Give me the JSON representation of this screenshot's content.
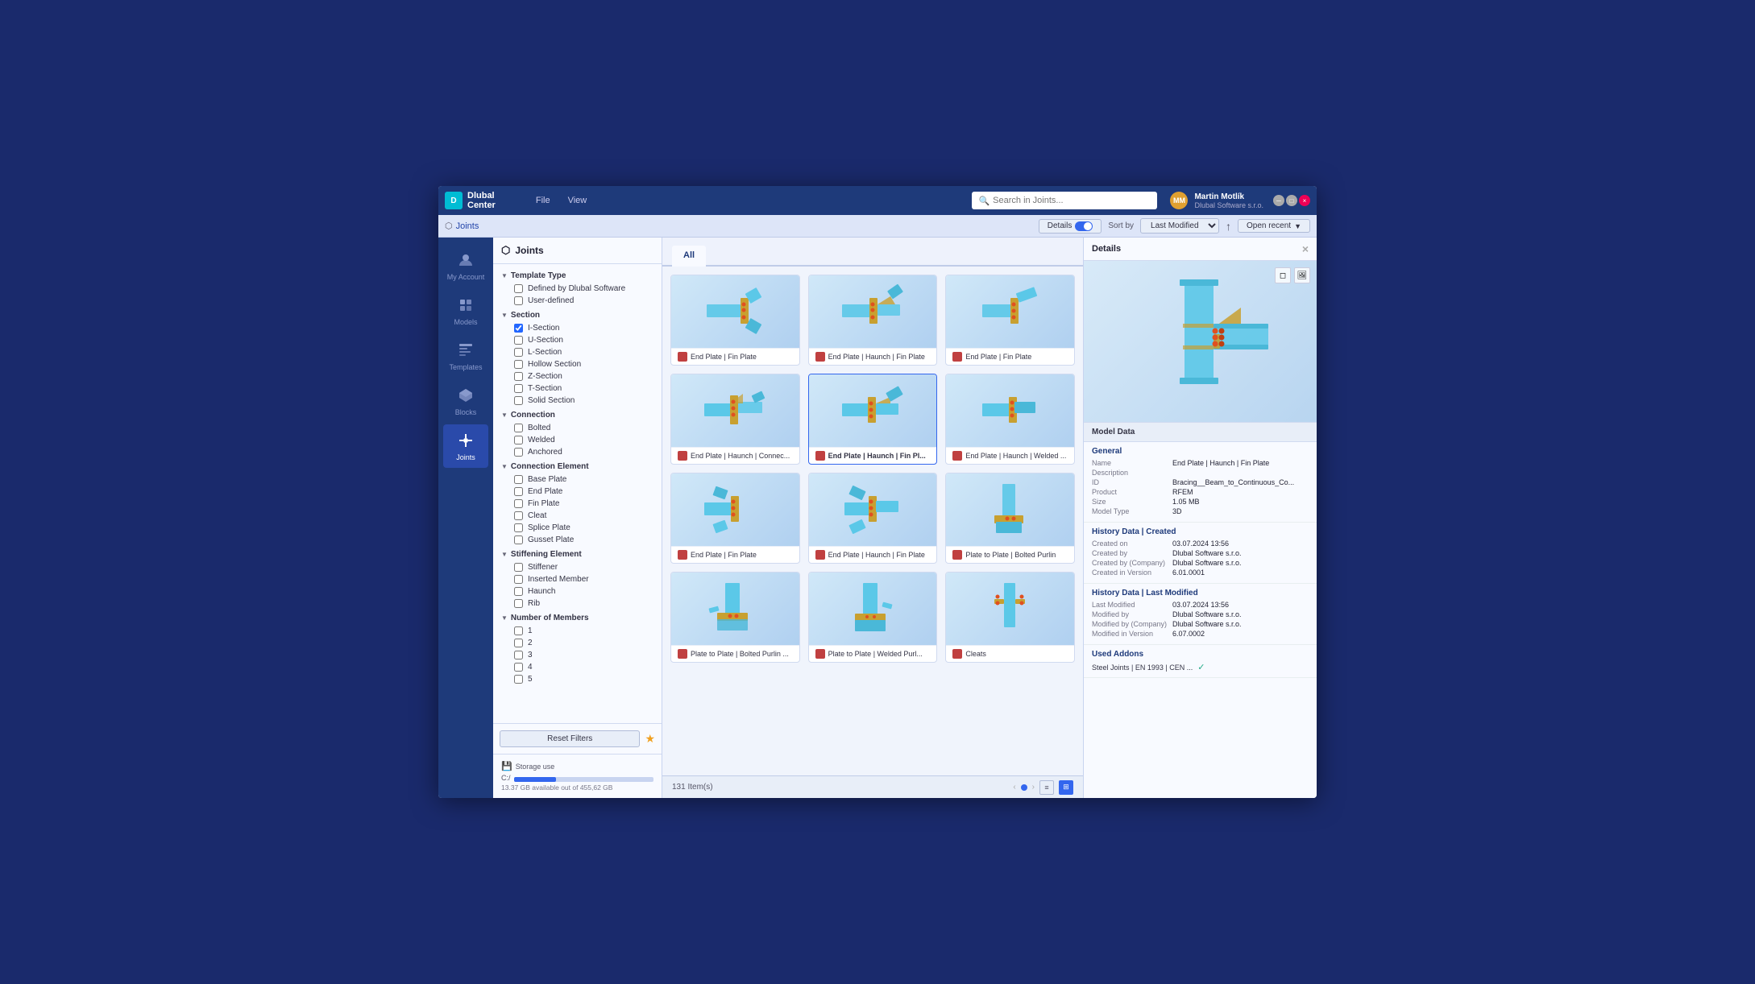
{
  "app": {
    "name": "Dlubal",
    "center": "Center",
    "logo": "D"
  },
  "titlebar": {
    "menu": [
      "File",
      "View"
    ],
    "search_placeholder": "Search in Joints...",
    "user": {
      "name": "Martin Motlík",
      "company": "Dlubal Software s.r.o.",
      "initials": "MM"
    },
    "win_buttons": [
      "–",
      "□",
      "×"
    ]
  },
  "toolbar": {
    "breadcrumb": "Joints",
    "details_label": "Details",
    "sort_label": "Sort by",
    "sort_value": "Last Modified",
    "open_recent_label": "Open recent",
    "open_recent_placeholder": ""
  },
  "nav": {
    "items": [
      {
        "id": "my-account",
        "label": "My Account",
        "icon": "account"
      },
      {
        "id": "models",
        "label": "Models",
        "icon": "models"
      },
      {
        "id": "templates",
        "label": "Templates",
        "icon": "templates"
      },
      {
        "id": "blocks",
        "label": "Blocks",
        "icon": "blocks"
      },
      {
        "id": "joints",
        "label": "Joints",
        "icon": "joints",
        "active": true
      }
    ]
  },
  "filter_panel": {
    "title": "Joints",
    "sections": [
      {
        "id": "template-type",
        "label": "Template Type",
        "expanded": true,
        "items": [
          {
            "id": "defined-by-dlubal",
            "label": "Defined by Dlubal Software",
            "checked": false
          },
          {
            "id": "user-defined",
            "label": "User-defined",
            "checked": false
          }
        ]
      },
      {
        "id": "section",
        "label": "Section",
        "expanded": true,
        "items": [
          {
            "id": "i-section",
            "label": "I-Section",
            "checked": true
          },
          {
            "id": "u-section",
            "label": "U-Section",
            "checked": false
          },
          {
            "id": "l-section",
            "label": "L-Section",
            "checked": false
          },
          {
            "id": "hollow-section",
            "label": "Hollow Section",
            "checked": false
          },
          {
            "id": "z-section",
            "label": "Z-Section",
            "checked": false
          },
          {
            "id": "t-section",
            "label": "T-Section",
            "checked": false
          },
          {
            "id": "solid-section",
            "label": "Solid Section",
            "checked": false
          }
        ]
      },
      {
        "id": "connection",
        "label": "Connection",
        "expanded": true,
        "items": [
          {
            "id": "bolted",
            "label": "Bolted",
            "checked": false
          },
          {
            "id": "welded",
            "label": "Welded",
            "checked": false
          },
          {
            "id": "anchored",
            "label": "Anchored",
            "checked": false
          }
        ]
      },
      {
        "id": "connection-element",
        "label": "Connection Element",
        "expanded": true,
        "items": [
          {
            "id": "base-plate",
            "label": "Base Plate",
            "checked": false
          },
          {
            "id": "end-plate",
            "label": "End Plate",
            "checked": false
          },
          {
            "id": "fin-plate",
            "label": "Fin Plate",
            "checked": false
          },
          {
            "id": "cleat",
            "label": "Cleat",
            "checked": false
          },
          {
            "id": "splice-plate",
            "label": "Splice Plate",
            "checked": false
          },
          {
            "id": "gusset-plate",
            "label": "Gusset Plate",
            "checked": false
          }
        ]
      },
      {
        "id": "stiffening-element",
        "label": "Stiffening Element",
        "expanded": true,
        "items": [
          {
            "id": "stiffener",
            "label": "Stiffener",
            "checked": false
          },
          {
            "id": "inserted-member",
            "label": "Inserted Member",
            "checked": false
          },
          {
            "id": "haunch",
            "label": "Haunch",
            "checked": false
          },
          {
            "id": "rib",
            "label": "Rib",
            "checked": false
          }
        ]
      },
      {
        "id": "number-of-members",
        "label": "Number of Members",
        "expanded": true,
        "items": [
          {
            "id": "num-1",
            "label": "1",
            "checked": false
          },
          {
            "id": "num-2",
            "label": "2",
            "checked": false
          },
          {
            "id": "num-3",
            "label": "3",
            "checked": false
          },
          {
            "id": "num-4",
            "label": "4",
            "checked": false
          },
          {
            "id": "num-5",
            "label": "5",
            "checked": false
          }
        ]
      }
    ],
    "reset_label": "Reset Filters",
    "storage": {
      "label": "Storage use",
      "drive": "C:/",
      "available": "13.37 GB available out of 455,62 GB",
      "fill_pct": 30
    }
  },
  "tabs": [
    {
      "id": "all",
      "label": "All",
      "active": true
    }
  ],
  "grid": {
    "items": [
      {
        "id": "ep-fin",
        "label": "End Plate | Fin Plate",
        "type": "rfem"
      },
      {
        "id": "ep-haunch-fin",
        "label": "End Plate | Haunch | Fin Plate",
        "type": "rfem"
      },
      {
        "id": "ep-fin2",
        "label": "End Plate | Fin Plate",
        "type": "rfem"
      },
      {
        "id": "ep-haunch-conn",
        "label": "End Plate | Haunch | Connec...",
        "type": "rfem"
      },
      {
        "id": "ep-haunch-finpl",
        "label": "End Plate | Haunch | Fin Pl...",
        "type": "rfem",
        "selected": true
      },
      {
        "id": "ep-haunch-weld",
        "label": "End Plate | Haunch | Welded ...",
        "type": "rfem"
      },
      {
        "id": "ep-fin3",
        "label": "End Plate | Fin Plate",
        "type": "rfem"
      },
      {
        "id": "ep-haunch-fin2",
        "label": "End Plate | Haunch | Fin Plate",
        "type": "rfem"
      },
      {
        "id": "plate-bolted-purlin",
        "label": "Plate to Plate | Bolted Purlin",
        "type": "rfem"
      },
      {
        "id": "plate-bolted-purlin2",
        "label": "Plate to Plate | Bolted Purlin ...",
        "type": "rfem"
      },
      {
        "id": "plate-welded-purlin",
        "label": "Plate to Plate | Welded Purl...",
        "type": "rfem"
      },
      {
        "id": "cleats",
        "label": "Cleats",
        "type": "rfem"
      }
    ]
  },
  "status_bar": {
    "count": "131 Item(s)",
    "view_list_label": "list",
    "view_grid_label": "grid"
  },
  "details": {
    "title": "Details",
    "model_data_label": "Model Data",
    "general": {
      "title": "General",
      "name_label": "Name",
      "name_value": "End Plate | Haunch | Fin Plate",
      "description_label": "Description",
      "description_value": "",
      "id_label": "ID",
      "id_value": "Bracing__Beam_to_Continuous_Co...",
      "product_label": "Product",
      "product_value": "RFEM",
      "size_label": "Size",
      "size_value": "1.05 MB",
      "model_type_label": "Model Type",
      "model_type_value": "3D"
    },
    "history_created": {
      "title": "History Data | Created",
      "created_on_label": "Created on",
      "created_on_value": "03.07.2024 13:56",
      "created_by_label": "Created by",
      "created_by_value": "Dlubal Software s.r.o.",
      "created_by_company_label": "Created by (Company)",
      "created_by_company_value": "Dlubal Software s.r.o.",
      "created_in_version_label": "Created in Version",
      "created_in_version_value": "6.01.0001"
    },
    "history_modified": {
      "title": "History Data | Last Modified",
      "last_modified_label": "Last Modified",
      "last_modified_value": "03.07.2024 13:56",
      "modified_by_label": "Modified by",
      "modified_by_value": "Dlubal Software s.r.o.",
      "modified_by_company_label": "Modified by (Company)",
      "modified_by_company_value": "Dlubal Software s.r.o.",
      "modified_in_version_label": "Modified in Version",
      "modified_in_version_value": "6.07.0002"
    },
    "used_addons": {
      "title": "Used Addons",
      "addon_label": "Steel Joints | EN 1993 | CEN ...",
      "addon_check": "✓"
    }
  }
}
